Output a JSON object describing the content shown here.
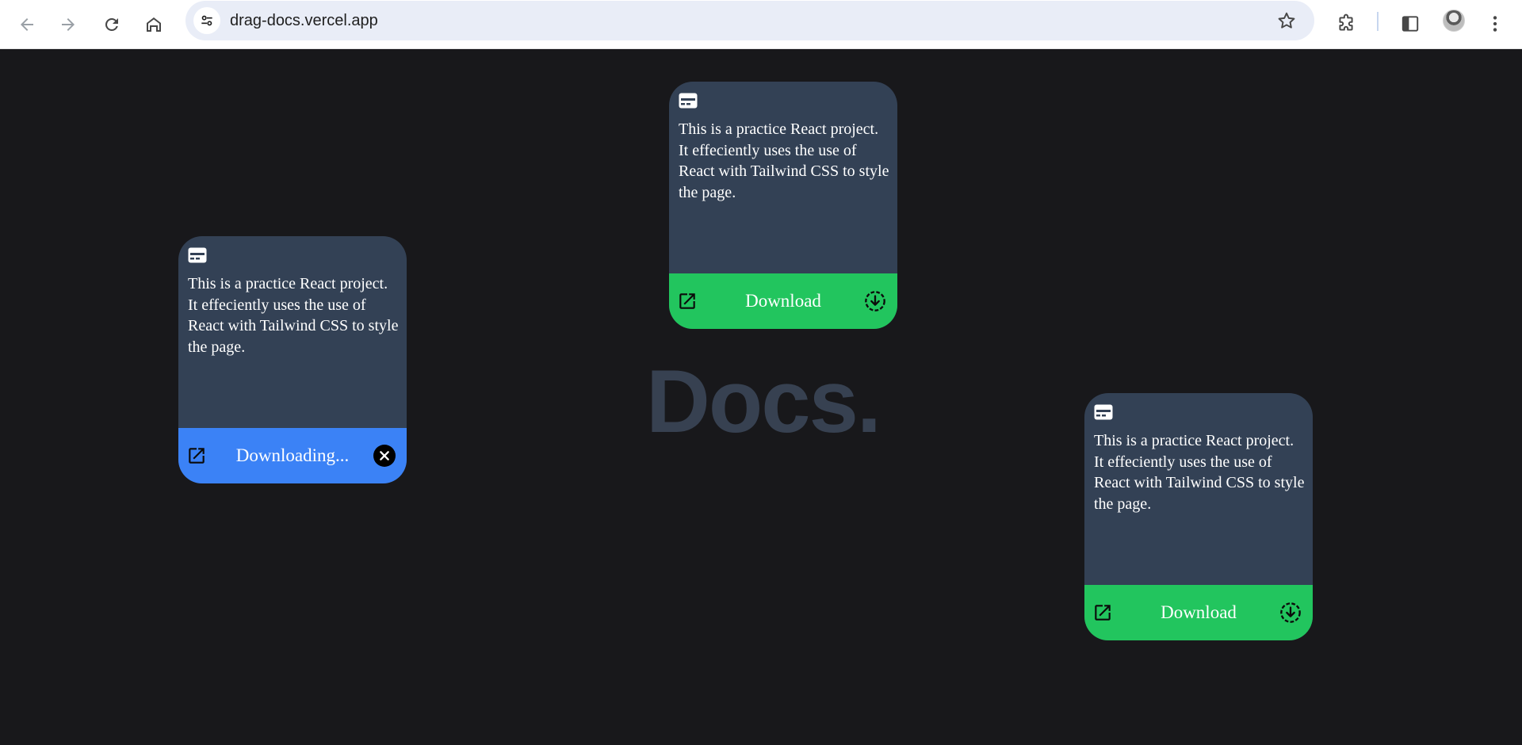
{
  "browser": {
    "url": "drag-docs.vercel.app"
  },
  "page": {
    "title": "Docs.",
    "colors": {
      "background": "#18181b",
      "card": "#334155",
      "download_green": "#22c55e",
      "downloading_blue": "#3b82f6",
      "title": "#374151"
    }
  },
  "cards": [
    {
      "description": "This is a practice React project. It effeciently uses the use of React with Tailwind CSS to style the page.",
      "footer_label": "Downloading...",
      "footer_icon": "close-circle-icon"
    },
    {
      "description": "This is a practice React project. It effeciently uses the use of React with Tailwind CSS to style the page.",
      "footer_label": "Download",
      "footer_icon": "download-circle-icon"
    },
    {
      "description": "This is a practice React project. It effeciently uses the use of React with Tailwind CSS to style the page.",
      "footer_label": "Download",
      "footer_icon": "download-circle-icon"
    }
  ]
}
